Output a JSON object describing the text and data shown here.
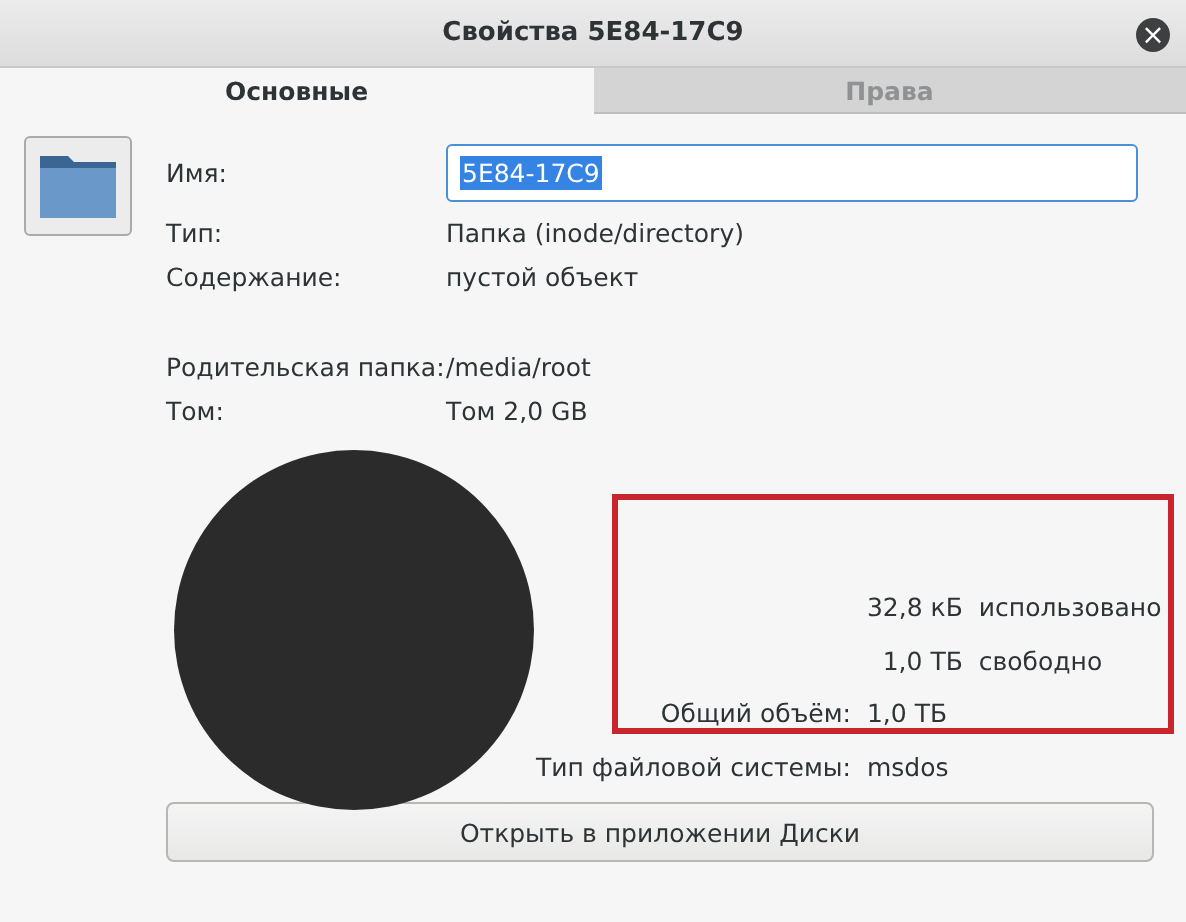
{
  "window": {
    "title": "Свойства 5E84-17C9",
    "close_glyph": "×"
  },
  "tabs": [
    {
      "label": "Основные",
      "selected": true
    },
    {
      "label": "Права",
      "selected": false
    }
  ],
  "name_field": {
    "label": "Имя:",
    "value": "5E84-17C9",
    "text_selected": true
  },
  "info_rows": [
    {
      "label": "Тип:",
      "value": "Папка (inode/directory)"
    },
    {
      "label": "Содержание:",
      "value": "пустой объект"
    },
    {
      "label": "Родительская папка:",
      "value": "/media/root",
      "gap_before": true
    },
    {
      "label": "Том:",
      "value": "Том 2,0 GB"
    }
  ],
  "usage": {
    "highlighted": true,
    "rows": [
      {
        "kind": "stat",
        "value": "32,8 кБ",
        "label": "использовано"
      },
      {
        "kind": "stat",
        "value": "1,0 ТБ",
        "label": "свободно"
      },
      {
        "kind": "total",
        "label": "Общий объём:",
        "value": "1,0 ТБ"
      }
    ]
  },
  "filesystem": {
    "label": "Тип файловой системы:",
    "value": "msdos"
  },
  "open_button": "Открыть в приложении Диски"
}
